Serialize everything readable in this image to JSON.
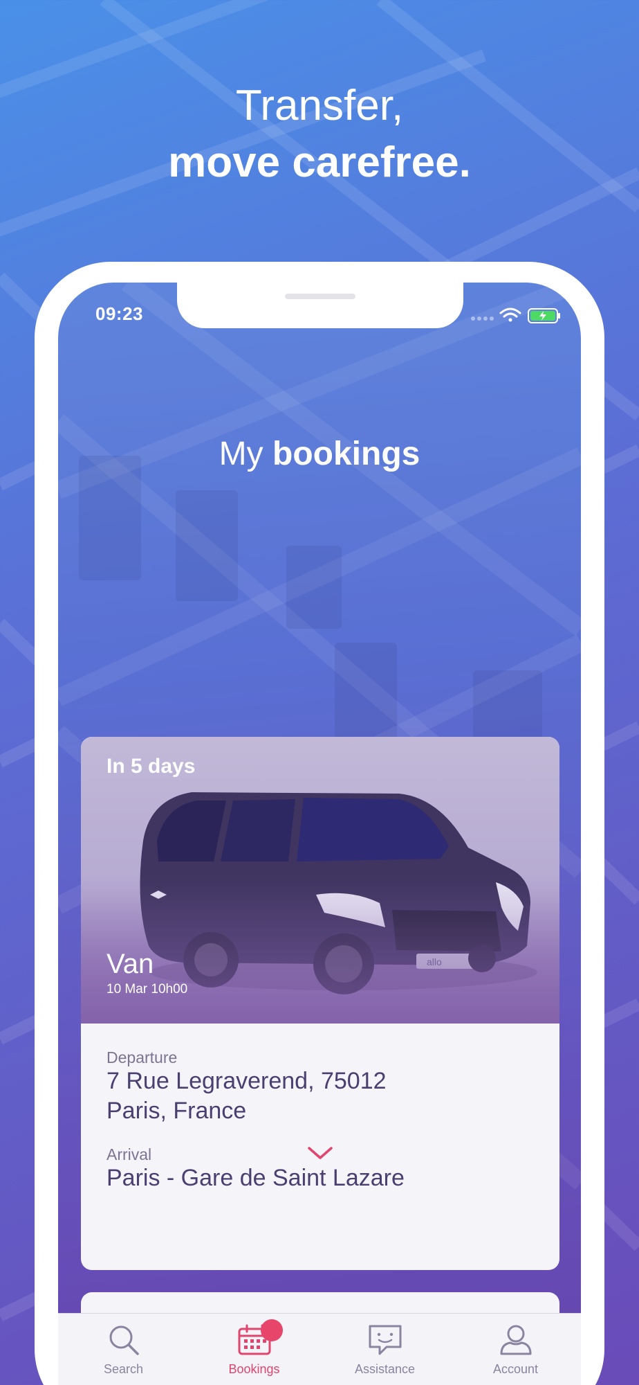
{
  "headline": {
    "line1": "Transfer,",
    "line2": "move carefree."
  },
  "status_bar": {
    "time": "09:23"
  },
  "page_title": {
    "regular": "My",
    "bold": "bookings"
  },
  "booking": {
    "countdown": "In 5 days",
    "vehicle_type": "Van",
    "datetime": "10 Mar 10h00",
    "departure_label": "Departure",
    "departure_line1": "7 Rue Legraverend, 75012",
    "departure_line2": "Paris, France",
    "arrival_label": "Arrival",
    "arrival_value": "Paris - Gare de Saint Lazare",
    "plate_text": "allo"
  },
  "tabs": [
    {
      "label": "Search",
      "icon": "search-icon",
      "active": false
    },
    {
      "label": "Bookings",
      "icon": "calendar-icon",
      "active": true
    },
    {
      "label": "Assistance",
      "icon": "chat-smile-icon",
      "active": false
    },
    {
      "label": "Account",
      "icon": "user-icon",
      "active": false
    }
  ],
  "colors": {
    "accent": "#e0456e",
    "text_dark": "#4b3f72",
    "text_muted": "#7d7491"
  }
}
